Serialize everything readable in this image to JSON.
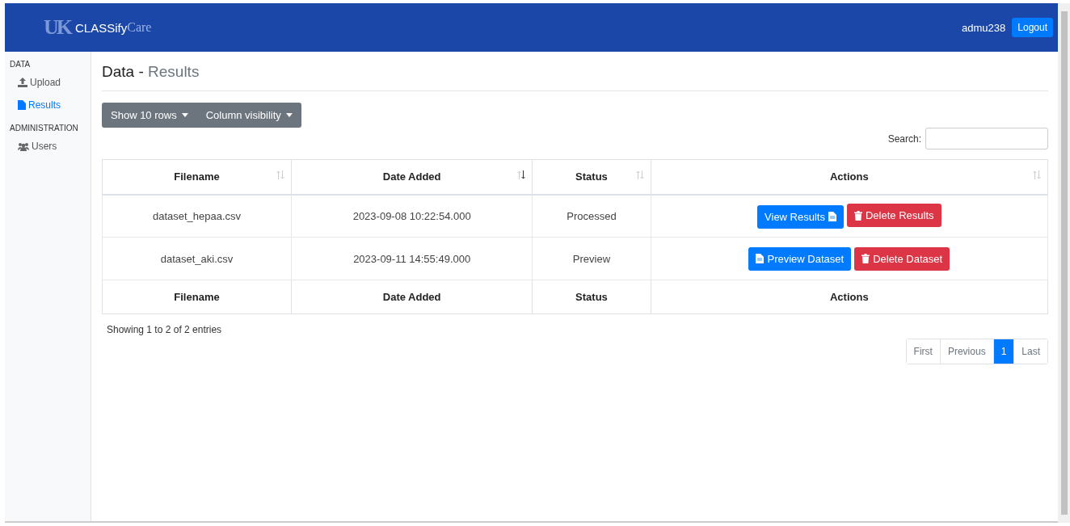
{
  "navbar": {
    "logo": "UK",
    "brand": "CLASSify",
    "brand_suffix": "Care",
    "user": "admu238",
    "logout": "Logout"
  },
  "sidebar": [
    {
      "heading": "DATA",
      "items": [
        {
          "label": "Upload",
          "kind": "upload",
          "selected": false
        },
        {
          "label": "Results",
          "kind": "file",
          "selected": true
        }
      ]
    },
    {
      "heading": "ADMINISTRATION",
      "items": [
        {
          "label": "Users",
          "kind": "users",
          "selected": false
        }
      ]
    }
  ],
  "page": {
    "title": "Data",
    "separator": "-",
    "subtitle": "Results"
  },
  "toolbar": {
    "buttons": [
      "Show 10 rows",
      "Column visibility"
    ],
    "search_label": "Search:"
  },
  "table": {
    "columns": [
      {
        "label": "Filename",
        "sorted": false
      },
      {
        "label": "Date Added",
        "sorted": true
      },
      {
        "label": "Status",
        "sorted": false
      },
      {
        "label": "Actions",
        "sorted": false
      }
    ],
    "rows": [
      {
        "filename": "dataset_hepaa.csv",
        "date": "2023-09-08 10:22:54.000",
        "status": "Processed",
        "actions": [
          {
            "label": "View Results",
            "kind": "view"
          },
          {
            "label": "Delete Results",
            "kind": "delete"
          }
        ]
      },
      {
        "filename": "dataset_aki.csv",
        "date": "2023-09-11 14:55:49.000",
        "status": "Preview",
        "actions": [
          {
            "label": "Preview Dataset",
            "kind": "preview"
          },
          {
            "label": "Delete Dataset",
            "kind": "delete"
          }
        ]
      }
    ],
    "footer": [
      "Filename",
      "Date Added",
      "Status",
      "Actions"
    ]
  },
  "info": "Showing 1 to 2 of 2 entries",
  "pagination": [
    {
      "label": "First",
      "selected": false
    },
    {
      "label": "Previous",
      "selected": false
    },
    {
      "label": "1",
      "selected": true
    },
    {
      "label": "Last",
      "selected": false
    }
  ]
}
